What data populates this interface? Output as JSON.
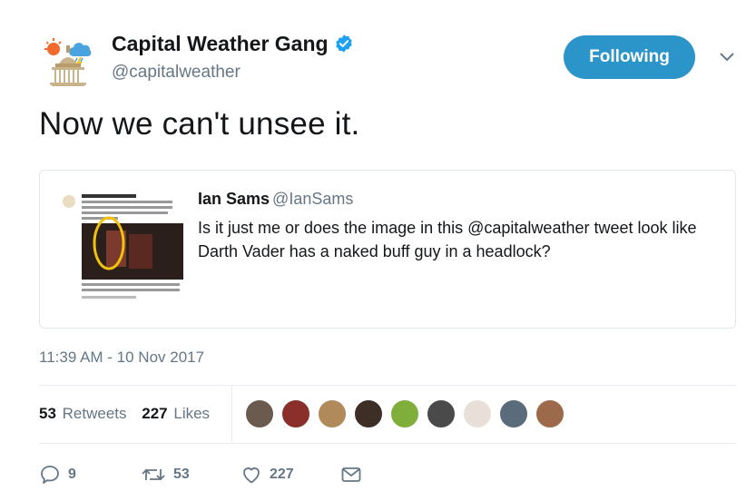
{
  "author": {
    "name": "Capital Weather Gang",
    "handle": "@capitalweather",
    "verified": true
  },
  "follow_button": {
    "label": "Following"
  },
  "tweet": {
    "text": "Now we can't unsee it."
  },
  "quoted_tweet": {
    "name": "Ian Sams",
    "handle": "@IanSams",
    "text": "Is it just me or does the image in this @capitalweather tweet look like Darth Vader has a naked buff guy in a headlock?"
  },
  "timestamp": "11:39 AM - 10 Nov 2017",
  "stats": {
    "retweets_count": "53",
    "retweets_label": "Retweets",
    "likes_count": "227",
    "likes_label": "Likes"
  },
  "actions": {
    "reply_count": "9",
    "retweet_count": "53",
    "like_count": "227"
  },
  "colors": {
    "accent": "#2b95c9",
    "verified": "#1da1f2",
    "muted": "#657786"
  },
  "likers": [
    "avatar-1",
    "avatar-2",
    "avatar-3",
    "avatar-4",
    "avatar-5",
    "avatar-6",
    "avatar-7",
    "avatar-8",
    "avatar-9"
  ]
}
